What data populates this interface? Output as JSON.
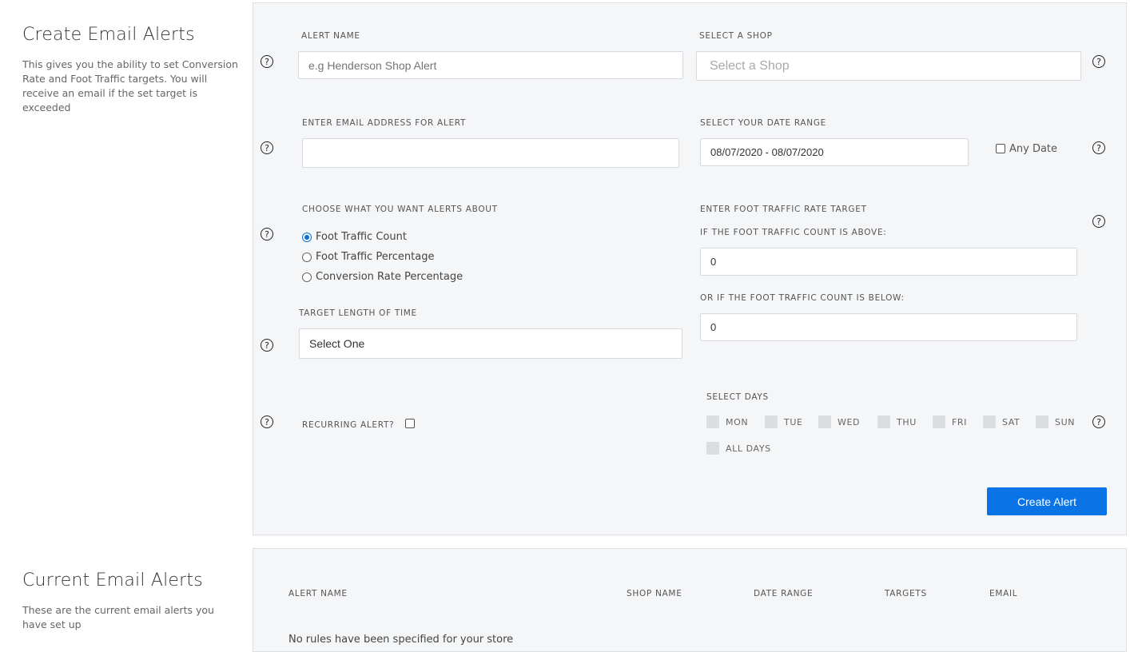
{
  "create": {
    "title": "Create Email Alerts",
    "description": "This gives you the ability to set Conversion Rate and Foot Traffic targets. You will receive an email if the set target is exceeded"
  },
  "form": {
    "alert_name": {
      "label": "ALERT NAME",
      "placeholder": "e.g Henderson Shop Alert",
      "value": ""
    },
    "shop": {
      "label": "SELECT A SHOP",
      "placeholder": "Select a Shop"
    },
    "email": {
      "label": "ENTER EMAIL ADDRESS FOR ALERT",
      "value": ""
    },
    "date_range": {
      "label": "SELECT YOUR DATE RANGE",
      "value": "08/07/2020 - 08/07/2020",
      "any_date_label": "Any Date",
      "any_date_checked": false
    },
    "alert_type": {
      "label": "CHOOSE WHAT YOU WANT ALERTS ABOUT",
      "options": [
        "Foot Traffic Count",
        "Foot Traffic Percentage",
        "Conversion Rate Percentage"
      ],
      "selected": 0
    },
    "target": {
      "label": "ENTER FOOT TRAFFIC RATE TARGET",
      "above_label": "IF THE FOOT TRAFFIC COUNT IS ABOVE:",
      "above_value": "0",
      "below_label": "OR IF THE FOOT TRAFFIC COUNT IS BELOW:",
      "below_value": "0"
    },
    "length": {
      "label": "TARGET LENGTH OF TIME",
      "value": "Select One"
    },
    "recurring": {
      "label": "RECURRING ALERT?",
      "checked": false
    },
    "days": {
      "label": "SELECT DAYS",
      "items": [
        "MON",
        "TUE",
        "WED",
        "THU",
        "FRI",
        "SAT",
        "SUN"
      ],
      "all_label": "ALL DAYS"
    },
    "help_glyph": "?",
    "submit_label": "Create Alert"
  },
  "current": {
    "title": "Current Email Alerts",
    "description": "These are the current email alerts you have set up",
    "columns": [
      "ALERT NAME",
      "SHOP NAME",
      "DATE RANGE",
      "TARGETS",
      "EMAIL"
    ],
    "empty_message": "No rules have been specified for your store"
  },
  "colors": {
    "accent": "#0a73e6",
    "panel_bg": "#f5f6f8"
  }
}
